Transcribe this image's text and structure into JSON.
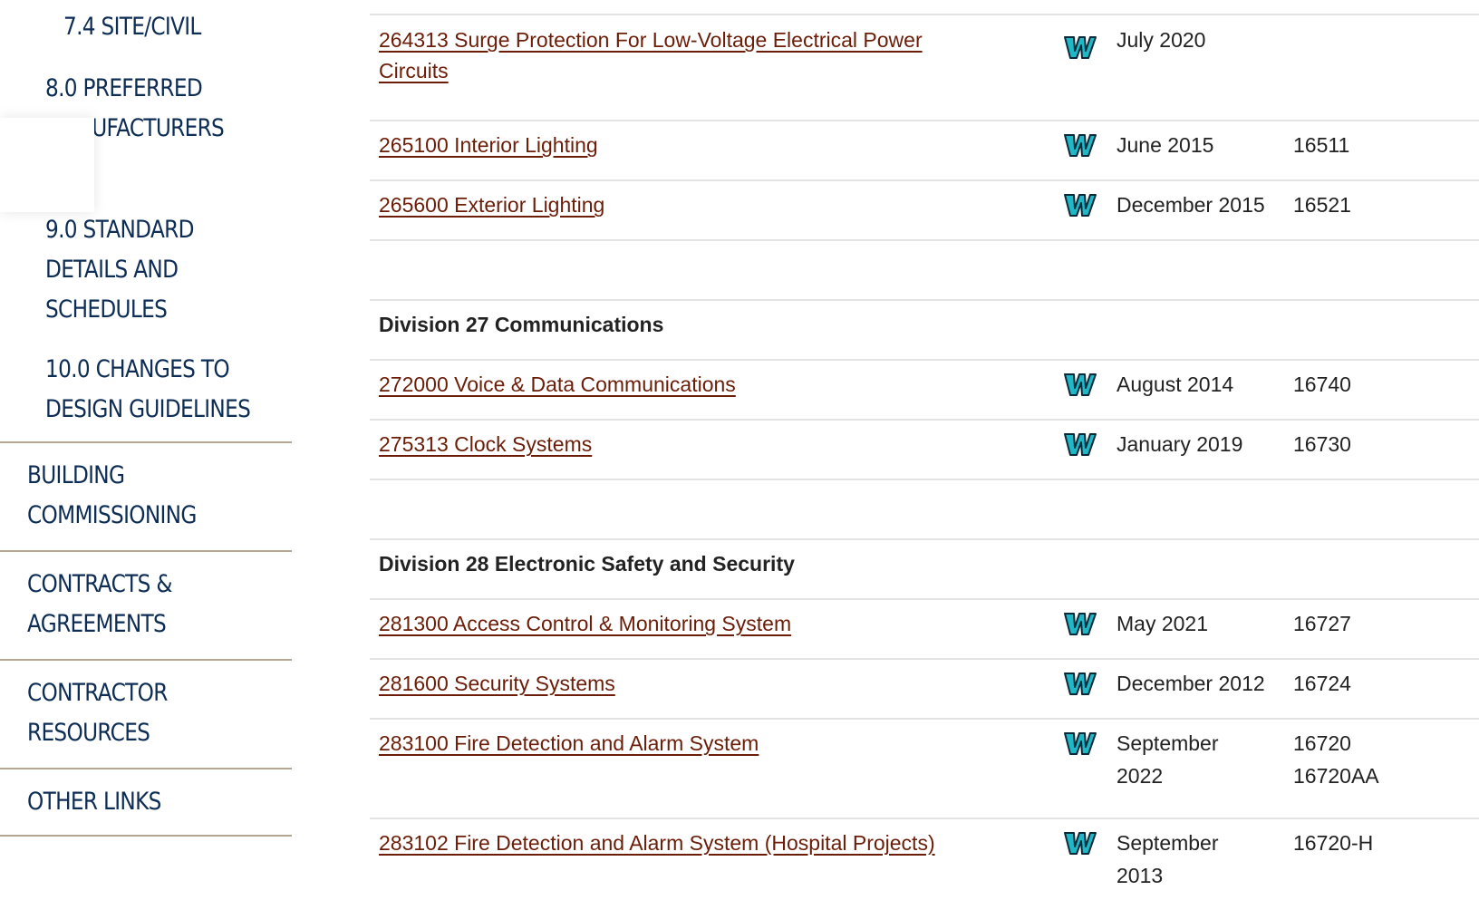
{
  "sidebar": {
    "sub_items": [
      {
        "label_lines": [
          "7.4 SITE/CIVIL"
        ]
      },
      {
        "label_lines": [
          "8.0 PREFERRED",
          "MANUFACTURERS"
        ]
      },
      {
        "label_lines": [
          "9.0 STANDARD",
          "DETAILS AND",
          "SCHEDULES"
        ]
      },
      {
        "label_lines": [
          "10.0 CHANGES TO",
          "DESIGN GUIDELINES"
        ]
      }
    ],
    "main_items": [
      {
        "label_lines": [
          "BUILDING",
          "COMMISSIONING"
        ]
      },
      {
        "label_lines": [
          "CONTRACTS &",
          "AGREEMENTS"
        ]
      },
      {
        "label_lines": [
          "CONTRACTOR",
          "RESOURCES"
        ]
      },
      {
        "label_lines": [
          "OTHER LINKS"
        ]
      }
    ]
  },
  "table": {
    "rows": [
      {
        "title": "264313 Surge Protection For Low-Voltage Electrical Power Circuits",
        "icon": "word-doc-icon",
        "date": "July 2020",
        "old_number": ""
      },
      {
        "title": "265100 Interior Lighting",
        "icon": "word-doc-icon",
        "date": "June 2015",
        "old_number": "16511"
      },
      {
        "title": "265600 Exterior Lighting",
        "icon": "word-doc-icon",
        "date": "December 2015",
        "old_number": "16521"
      },
      {
        "division": "Division 27 Communications"
      },
      {
        "title": "272000 Voice & Data Communications",
        "icon": "word-doc-icon",
        "date": "August 2014",
        "old_number": "16740"
      },
      {
        "title": "275313 Clock Systems",
        "icon": "word-doc-icon",
        "date": "January 2019",
        "old_number": "16730"
      },
      {
        "division": "Division 28 Electronic Safety and Security"
      },
      {
        "title": "281300 Access Control & Monitoring System",
        "icon": "word-doc-icon",
        "date": "May 2021",
        "old_number": "16727"
      },
      {
        "title": "281600 Security Systems",
        "icon": "word-doc-icon",
        "date": "December 2012",
        "old_number": "16724"
      },
      {
        "title": "283100 Fire Detection and Alarm System",
        "icon": "word-doc-icon",
        "date": "September 2022",
        "old_number": "16720 16720AA"
      },
      {
        "title": "283102 Fire Detection and Alarm System (Hospital Projects)",
        "icon": "word-doc-icon",
        "date": "September 2013",
        "old_number": "16720-H"
      }
    ]
  },
  "colors": {
    "nav_text": "#0d2d55",
    "divider": "#b3a792",
    "link": "#6b1d08",
    "icon_fill": "#1fb8c7",
    "icon_outline": "#0a2a3a"
  }
}
